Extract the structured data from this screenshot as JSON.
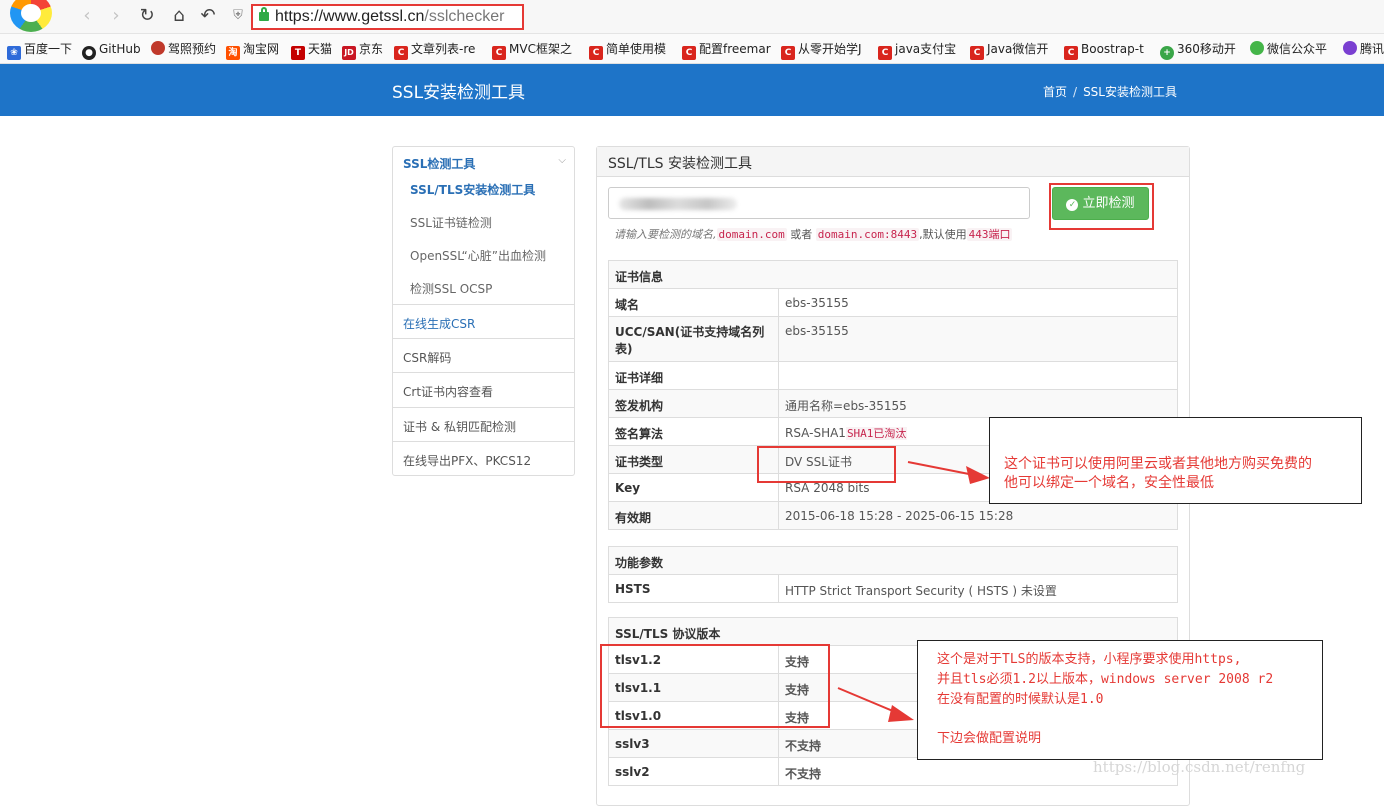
{
  "browser": {
    "url_host": "https://www.getssl.cn",
    "url_path": "/sslchecker",
    "bookmarks": [
      {
        "label": "百度一下",
        "icon": "baidu-icon",
        "color": "#2f6bd9"
      },
      {
        "label": "GitHub",
        "icon": "github-icon",
        "color": "#222222"
      },
      {
        "label": "驾照预约",
        "icon": "driving-icon",
        "color": "#c0392b"
      },
      {
        "label": "淘宝网",
        "icon": "taobao-icon",
        "color": "#ff5000"
      },
      {
        "label": "天猫",
        "icon": "tmall-icon",
        "color": "#c40000"
      },
      {
        "label": "京东",
        "icon": "jd-icon",
        "color": "#c91623"
      },
      {
        "label": "文章列表-re",
        "icon": "csdn-icon",
        "color": "#d9251d"
      },
      {
        "label": "MVC框架之",
        "icon": "csdn-icon",
        "color": "#d9251d"
      },
      {
        "label": "简单使用模",
        "icon": "csdn-icon",
        "color": "#d9251d"
      },
      {
        "label": "配置freemar",
        "icon": "csdn-icon",
        "color": "#d9251d"
      },
      {
        "label": "从零开始学J",
        "icon": "csdn-icon",
        "color": "#d9251d"
      },
      {
        "label": "java支付宝",
        "icon": "csdn-icon",
        "color": "#d9251d"
      },
      {
        "label": "Java微信开",
        "icon": "csdn-icon",
        "color": "#d9251d"
      },
      {
        "label": "Boostrap-t",
        "icon": "csdn-icon",
        "color": "#d9251d"
      },
      {
        "label": "360移动开",
        "icon": "360-icon",
        "color": "#3aa648"
      },
      {
        "label": "微信公众平",
        "icon": "wechat-icon",
        "color": "#44b549"
      },
      {
        "label": "腾讯",
        "icon": "tencent-icon",
        "color": "#7a3fd1"
      }
    ]
  },
  "site": {
    "title": "SSL安装检测工具",
    "breadcrumb": [
      "首页",
      "/",
      "SSL安装检测工具"
    ],
    "brand_color": "#1e74c8"
  },
  "sidebar": {
    "group_title": "SSL检测工具",
    "sub_items": [
      "SSL/TLS安装检测工具",
      "SSL证书链检测",
      "OpenSSL“心脏”出血检测",
      "检测SSL OCSP"
    ],
    "items": [
      "在线生成CSR",
      "CSR解码",
      "Crt证书内容查看",
      "证书 & 私钥匹配检测",
      "在线导出PFX、PKCS12"
    ]
  },
  "panel": {
    "title": "SSL/TLS 安装检测工具",
    "check_button": "立即检测",
    "hint_prefix": "请输入要检测的域名,",
    "hint_code1": "domain.com",
    "hint_or": "或者",
    "hint_code2": "domain.com:8443",
    "hint_suffix": ",默认使用",
    "hint_code3": "443端口"
  },
  "cert_table": {
    "header": "证书信息",
    "rows": [
      {
        "key": "域名",
        "value": "ebs-35155"
      },
      {
        "key": "UCC/SAN(证书支持域名列表)",
        "value": "ebs-35155"
      },
      {
        "key": "证书详细",
        "value": ""
      },
      {
        "key": "签发机构",
        "value": "通用名称=ebs-35155"
      },
      {
        "key": "签名算法",
        "value": "RSA-SHA1",
        "extra": "SHA1已淘汰"
      },
      {
        "key": "证书类型",
        "value": "DV SSL证书"
      },
      {
        "key": "Key",
        "value": "RSA 2048 bits"
      },
      {
        "key": "有效期",
        "value": "2015-06-18 15:28 - 2025-06-15 15:28"
      }
    ]
  },
  "feature_table": {
    "header": "功能参数",
    "rows": [
      {
        "key": "HSTS",
        "value": "HTTP Strict Transport Security ( HSTS ) 未设置"
      }
    ]
  },
  "protocol_table": {
    "header": "SSL/TLS 协议版本",
    "rows": [
      {
        "key": "tlsv1.2",
        "value": "支持"
      },
      {
        "key": "tlsv1.1",
        "value": "支持"
      },
      {
        "key": "tlsv1.0",
        "value": "支持"
      },
      {
        "key": "sslv3",
        "value": "不支持"
      },
      {
        "key": "sslv2",
        "value": "不支持"
      }
    ]
  },
  "annotations": {
    "note1_line1": "这个证书可以使用阿里云或者其他地方购买免费的",
    "note1_line2": "他可以绑定一个域名，安全性最低",
    "note2_line1": "这个是对于TLS的版本支持，小程序要求使用https,",
    "note2_line2": "并且tls必须1.2以上版本，windows server 2008 r2",
    "note2_line3": "在没有配置的时候默认是1.0",
    "note2_line4": "下边会做配置说明",
    "watermark": "https://blog.csdn.net/renfng",
    "accent_color": "#e53935"
  }
}
